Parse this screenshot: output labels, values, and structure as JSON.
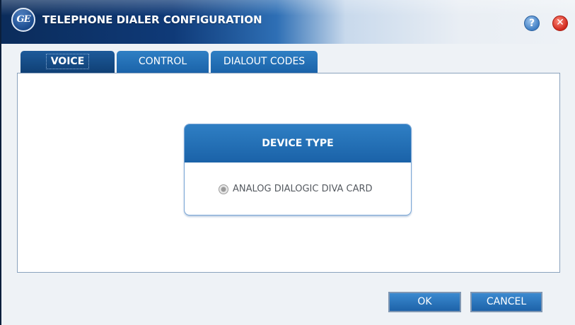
{
  "window": {
    "title": "TELEPHONE DIALER CONFIGURATION",
    "logo_text": "GE"
  },
  "titlebar": {
    "help_glyph": "?",
    "close_glyph": "✕"
  },
  "tabs": [
    {
      "label": "VOICE",
      "active": true
    },
    {
      "label": "CONTROL",
      "active": false
    },
    {
      "label": "DIALOUT CODES",
      "active": false
    }
  ],
  "device_type": {
    "header": "DEVICE TYPE",
    "options": [
      {
        "label": "ANALOG DIALOGIC DIVA CARD",
        "selected": true,
        "disabled": true
      }
    ]
  },
  "buttons": {
    "ok": "OK",
    "cancel": "CANCEL"
  },
  "colors": {
    "accent": "#1a62a8",
    "titlebar_dark": "#0b2c5b",
    "close": "#d0281c"
  }
}
